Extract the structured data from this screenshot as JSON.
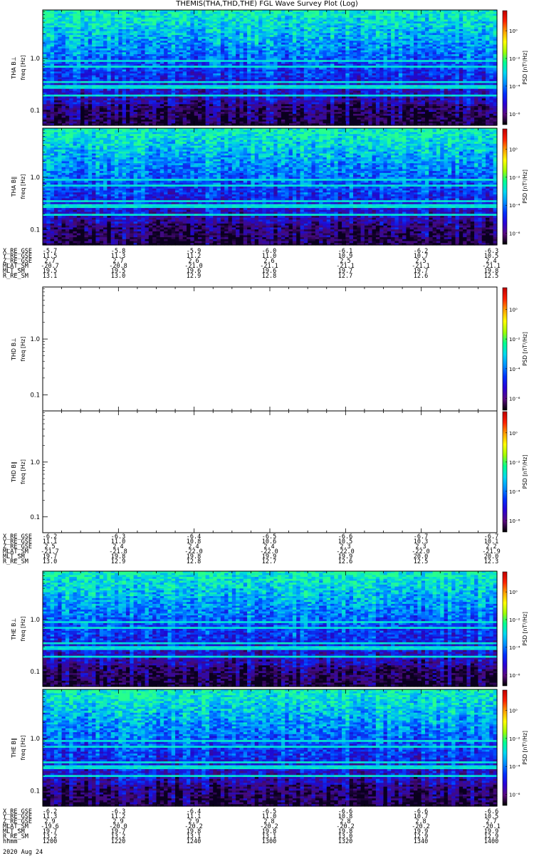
{
  "title": "THEMIS(THA,THD,THE) FGL Wave Survey Plot (Log)",
  "colors": {
    "colorbar": [
      "#000000",
      "#5a0a80",
      "#2a00d8",
      "#0030ff",
      "#0090ff",
      "#00d8f0",
      "#00ff90",
      "#a0ff00",
      "#ffff00",
      "#ffa000",
      "#ff2000",
      "#c00000"
    ],
    "spectrogram_low": "#3010a0",
    "spectrogram_mid": "#0060ff",
    "spectrogram_high": "#10e0a0",
    "stripe": "#40e0ff"
  },
  "chart_data": [
    {
      "type": "heatmap",
      "panel": "tha-bperp",
      "ylabel": [
        "THA B⊥",
        "freq [Hz]"
      ],
      "yscale": "log",
      "ytick_labels": [
        "1.0",
        "0.1"
      ],
      "cbar_label": "PSD [nT²/Hz]",
      "cbar_ticks": [
        "10⁰",
        "10⁻²",
        "10⁻⁴",
        "10⁻⁶"
      ],
      "has_data": true
    },
    {
      "type": "heatmap",
      "panel": "tha-bpar",
      "ylabel": [
        "THA B∥",
        "freq [Hz]"
      ],
      "yscale": "log",
      "ytick_labels": [
        "1.0",
        "0.1"
      ],
      "cbar_label": "PSD [nT²/Hz]",
      "cbar_ticks": [
        "10⁰",
        "10⁻²",
        "10⁻⁴",
        "10⁻⁶"
      ],
      "has_data": true
    },
    {
      "type": "heatmap",
      "panel": "thd-bperp",
      "ylabel": [
        "THD B⊥",
        "freq [Hz]"
      ],
      "yscale": "log",
      "ytick_labels": [
        "1.0",
        "0.1"
      ],
      "cbar_label": "PSD [nT²/Hz]",
      "cbar_ticks": [
        "10⁰",
        "10⁻²",
        "10⁻⁴",
        "10⁻⁶"
      ],
      "has_data": false
    },
    {
      "type": "heatmap",
      "panel": "thd-bpar",
      "ylabel": [
        "THD B∥",
        "freq [Hz]"
      ],
      "yscale": "log",
      "ytick_labels": [
        "1.0",
        "0.1"
      ],
      "cbar_label": "PSD [nT²/Hz]",
      "cbar_ticks": [
        "10⁰",
        "10⁻²",
        "10⁻⁴",
        "10⁻⁶"
      ],
      "has_data": false
    },
    {
      "type": "heatmap",
      "panel": "the-bperp",
      "ylabel": [
        "THE B⊥",
        "freq [Hz]"
      ],
      "yscale": "log",
      "ytick_labels": [
        "1.0",
        "0.1"
      ],
      "cbar_label": "PSD [nT²/Hz]",
      "cbar_ticks": [
        "10⁰",
        "10⁻²",
        "10⁻⁴",
        "10⁻⁶"
      ],
      "has_data": true
    },
    {
      "type": "heatmap",
      "panel": "the-bpar",
      "ylabel": [
        "THE B∥",
        "freq [Hz]"
      ],
      "yscale": "log",
      "ytick_labels": [
        "1.0",
        "0.1"
      ],
      "cbar_label": "PSD [nT²/Hz]",
      "cbar_ticks": [
        "10⁰",
        "10⁻²",
        "10⁻⁴",
        "10⁻⁶"
      ],
      "has_data": true
    }
  ],
  "ephemeris": [
    {
      "probe": "tha",
      "rows": [
        {
          "label": "X_RE_GSE",
          "values": [
            "-5.7",
            "-5.8",
            "-5.9",
            "-6.0",
            "-6.1",
            "-6.2",
            "-6.3"
          ]
        },
        {
          "label": "Y_RE_GSE",
          "values": [
            "11.5",
            "11.3",
            "11.2",
            "11.0",
            "10.9",
            "10.7",
            "10.5"
          ]
        },
        {
          "label": "Z_RE_GSE",
          "values": [
            "2.7",
            "2.7",
            "2.6",
            "2.6",
            "2.5",
            "2.5",
            "2.4"
          ]
        },
        {
          "label": "MLAT_SM",
          "values": [
            "-20.7",
            "-20.8",
            "-21.0",
            "-21.1",
            "-21.1",
            "-21.1",
            "-21.1"
          ]
        },
        {
          "label": "MLT_SM",
          "values": [
            "19.5",
            "19.5",
            "19.6",
            "19.6",
            "19.7",
            "19.7",
            "19.8"
          ]
        },
        {
          "label": "R_RE_SM",
          "values": [
            "13.1",
            "13.0",
            "12.9",
            "12.8",
            "12.7",
            "12.6",
            "12.5"
          ]
        }
      ]
    },
    {
      "probe": "thd",
      "rows": [
        {
          "label": "X_RE_GSE",
          "values": [
            "-6.2",
            "-6.3",
            "-6.4",
            "-6.5",
            "-6.6",
            "-6.7",
            "-6.7"
          ]
        },
        {
          "label": "Y_RE_GSE",
          "values": [
            "11.1",
            "11.0",
            "10.8",
            "10.6",
            "10.5",
            "10.3",
            "10.1"
          ]
        },
        {
          "label": "Z_RE_GSE",
          "values": [
            "2.5",
            "2.4",
            "2.4",
            "2.4",
            "2.3",
            "2.3",
            "2.2"
          ]
        },
        {
          "label": "MLAT_SM",
          "values": [
            "-21.7",
            "-21.8",
            "-22.0",
            "-22.0",
            "-22.0",
            "-22.0",
            "-21.9"
          ]
        },
        {
          "label": "MLT_SM",
          "values": [
            "19.7",
            "19.8",
            "19.8",
            "19.9",
            "19.9",
            "20.0",
            "20.0"
          ]
        },
        {
          "label": "R_RE_SM",
          "values": [
            "13.0",
            "12.9",
            "12.8",
            "12.7",
            "12.6",
            "12.5",
            "12.3"
          ]
        }
      ]
    },
    {
      "probe": "the",
      "rows": [
        {
          "label": "X_RE_GSE",
          "values": [
            "-6.2",
            "-6.3",
            "-6.4",
            "-6.5",
            "-6.6",
            "-6.6",
            "-6.6"
          ]
        },
        {
          "label": "Y_RE_GSE",
          "values": [
            "11.3",
            "11.2",
            "11.1",
            "11.0",
            "10.8",
            "10.7",
            "10.5"
          ]
        },
        {
          "label": "Z_RE_GSE",
          "values": [
            "2.9",
            "2.9",
            "2.9",
            "2.8",
            "2.8",
            "2.8",
            "2.7"
          ]
        },
        {
          "label": "MLAT_SM",
          "values": [
            "-19.6",
            "-20.0",
            "-20.2",
            "-20.2",
            "-20.2",
            "-20.2",
            "-20.1"
          ]
        },
        {
          "label": "MLT_SM",
          "values": [
            "19.7",
            "19.7",
            "19.8",
            "19.8",
            "19.8",
            "19.9",
            "19.9"
          ]
        },
        {
          "label": "R_RE_SM",
          "values": [
            "13.2",
            "13.2",
            "13.1",
            "13.1",
            "13.0",
            "12.9",
            "12.9"
          ]
        },
        {
          "label": "hhmm",
          "values": [
            "1200",
            "1220",
            "1240",
            "1300",
            "1320",
            "1340",
            "1400"
          ]
        }
      ]
    }
  ],
  "date_label": "2020 Aug 24"
}
